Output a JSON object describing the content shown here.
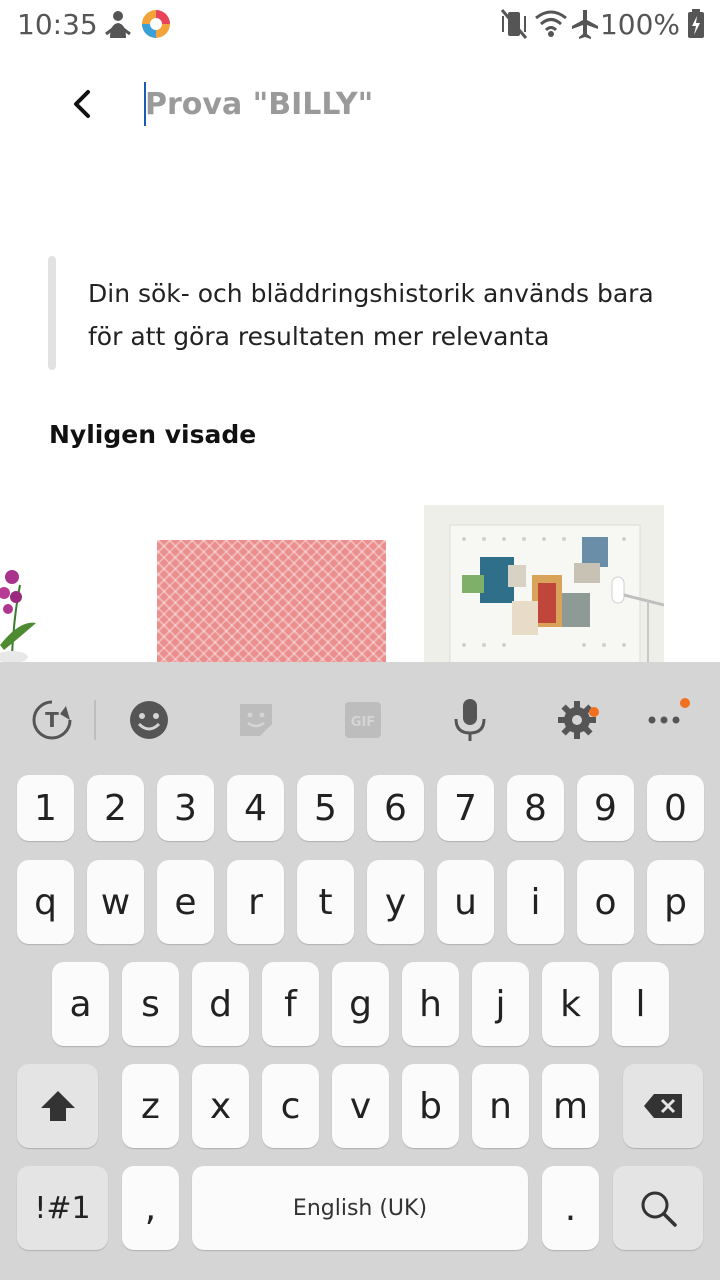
{
  "status_bar": {
    "time": "10:35",
    "battery_percent": "100%",
    "icons_left": [
      "person-icon",
      "app-logo-icon"
    ],
    "icons_right": [
      "vibrate-mute-icon",
      "wifi-icon",
      "airplane-icon",
      "battery-charging-icon"
    ]
  },
  "search": {
    "placeholder": "Prova \"BILLY\"",
    "value": ""
  },
  "info": {
    "text": "Din sök- och bläddringshistorik används bara för att göra resultaten mer relevanta"
  },
  "recent": {
    "title": "Nyligen visade",
    "items": [
      {
        "name": "orchid-plant-image"
      },
      {
        "name": "pink-rug-image"
      },
      {
        "name": "pegboard-image"
      }
    ]
  },
  "keyboard": {
    "toolbar": [
      "translate-icon",
      "emoji-icon",
      "sticker-icon",
      "gif-icon",
      "mic-icon",
      "settings-icon",
      "more-icon"
    ],
    "gif_label": "GIF",
    "row_numbers": [
      "1",
      "2",
      "3",
      "4",
      "5",
      "6",
      "7",
      "8",
      "9",
      "0"
    ],
    "row1": [
      "q",
      "w",
      "e",
      "r",
      "t",
      "y",
      "u",
      "i",
      "o",
      "p"
    ],
    "row2": [
      "a",
      "s",
      "d",
      "f",
      "g",
      "h",
      "j",
      "k",
      "l"
    ],
    "row3": [
      "z",
      "x",
      "c",
      "v",
      "b",
      "n",
      "m"
    ],
    "symbols_label": "!#1",
    "comma_label": ",",
    "space_label": "English (UK)",
    "period_label": ".",
    "accent_color": "#f07020"
  }
}
